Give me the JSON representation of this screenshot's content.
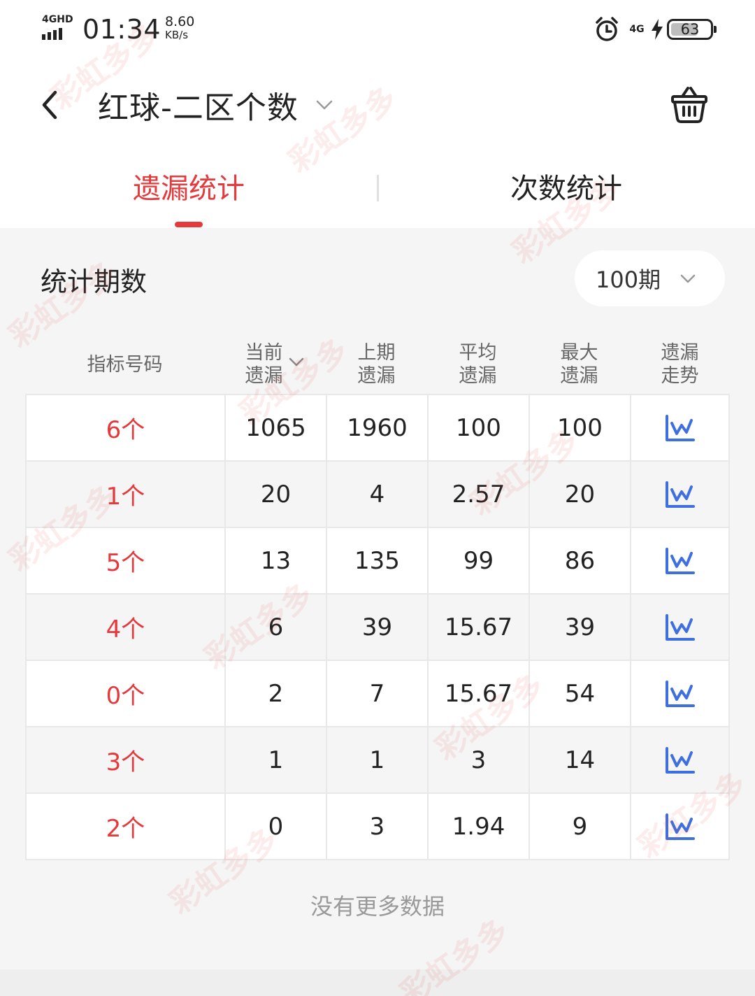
{
  "status_bar": {
    "network_type": "4GHD",
    "time": "01:34",
    "speed_value": "8.60",
    "speed_unit": "KB/s",
    "network_right": "4G",
    "battery": "63"
  },
  "header": {
    "title": "红球-二区个数"
  },
  "tabs": [
    {
      "label": "遗漏统计",
      "active": true
    },
    {
      "label": "次数统计",
      "active": false
    }
  ],
  "period": {
    "label": "统计期数",
    "selected": "100期"
  },
  "table": {
    "columns": {
      "index": "指标号码",
      "current_line1": "当前",
      "current_line2": "遗漏",
      "prev_line1": "上期",
      "prev_line2": "遗漏",
      "avg_line1": "平均",
      "avg_line2": "遗漏",
      "max_line1": "最大",
      "max_line2": "遗漏",
      "trend_line1": "遗漏",
      "trend_line2": "走势"
    },
    "rows": [
      {
        "index": "6个",
        "current": "1065",
        "prev": "1960",
        "avg": "100",
        "max": "100"
      },
      {
        "index": "1个",
        "current": "20",
        "prev": "4",
        "avg": "2.57",
        "max": "20"
      },
      {
        "index": "5个",
        "current": "13",
        "prev": "135",
        "avg": "99",
        "max": "86"
      },
      {
        "index": "4个",
        "current": "6",
        "prev": "39",
        "avg": "15.67",
        "max": "39"
      },
      {
        "index": "0个",
        "current": "2",
        "prev": "7",
        "avg": "15.67",
        "max": "54"
      },
      {
        "index": "3个",
        "current": "1",
        "prev": "1",
        "avg": "3",
        "max": "14"
      },
      {
        "index": "2个",
        "current": "0",
        "prev": "3",
        "avg": "1.94",
        "max": "9"
      }
    ]
  },
  "footer": {
    "no_more": "没有更多数据"
  },
  "watermark": "彩虹多多",
  "colors": {
    "accent": "#e5393c",
    "trend_icon": "#3d6fe0",
    "background": "#f5f5f5"
  }
}
